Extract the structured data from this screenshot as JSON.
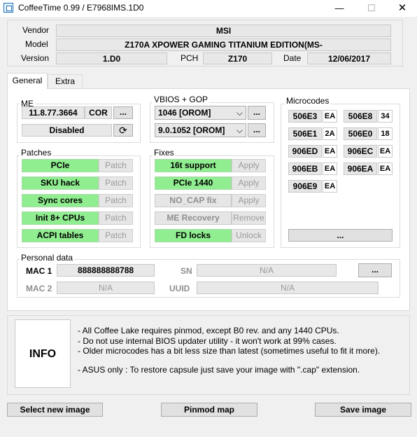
{
  "window": {
    "title": "CoffeeTime 0.99  /  E7968IMS.1D0",
    "minimize_glyph": "—",
    "maximize_glyph": "☐",
    "close_glyph": "✕"
  },
  "header": {
    "vendor_label": "Vendor",
    "vendor": "MSI",
    "model_label": "Model",
    "model": "Z170A XPOWER GAMING TITANIUM EDITION(MS-",
    "version_label": "Version",
    "version": "1.D0",
    "pch_label": "PCH",
    "pch": "Z170",
    "date_label": "Date",
    "date": "12/06/2017"
  },
  "tabs": [
    {
      "label": "General"
    },
    {
      "label": "Extra"
    }
  ],
  "me": {
    "title": "ME",
    "version": "11.8.77.3664",
    "type": "COR",
    "browse": "...",
    "state": "Disabled",
    "refresh_icon": "refresh-icon"
  },
  "vbios": {
    "title": "VBIOS + GOP",
    "vbios_value": "1046 [OROM]",
    "gop_value": "9.0.1052 [OROM]",
    "browse": "..."
  },
  "patches": {
    "title": "Patches",
    "items": [
      {
        "label": "PCIe",
        "action": "Patch"
      },
      {
        "label": "SKU hack",
        "action": "Patch"
      },
      {
        "label": "Sync cores",
        "action": "Patch"
      },
      {
        "label": "Init 8+ CPUs",
        "action": "Patch"
      },
      {
        "label": "ACPI tables",
        "action": "Patch"
      }
    ]
  },
  "fixes": {
    "title": "Fixes",
    "items": [
      {
        "label": "16t support",
        "action": "Apply",
        "active": true
      },
      {
        "label": "PCIe 1440",
        "action": "Apply",
        "active": true
      },
      {
        "label": "NO_CAP fix",
        "action": "Apply",
        "active": false
      },
      {
        "label": "ME Recovery",
        "action": "Remove",
        "active": false
      },
      {
        "label": "FD locks",
        "action": "Unlock",
        "active": true
      }
    ]
  },
  "microcodes": {
    "title": "Microcodes",
    "items": [
      {
        "cpuid": "506E3",
        "platform": "EA"
      },
      {
        "cpuid": "506E8",
        "platform": "34"
      },
      {
        "cpuid": "506E1",
        "platform": "2A"
      },
      {
        "cpuid": "506E0",
        "platform": "18"
      },
      {
        "cpuid": "906ED",
        "platform": "EA"
      },
      {
        "cpuid": "906EC",
        "platform": "EA"
      },
      {
        "cpuid": "906EB",
        "platform": "EA"
      },
      {
        "cpuid": "906EA",
        "platform": "EA"
      },
      {
        "cpuid": "906E9",
        "platform": "EA"
      }
    ],
    "browse": "..."
  },
  "personal": {
    "title": "Personal data",
    "mac1_label": "MAC 1",
    "mac1": "888888888788",
    "mac2_label": "MAC 2",
    "mac2": "N/A",
    "sn_label": "SN",
    "sn": "N/A",
    "uuid_label": "UUID",
    "uuid": "N/A",
    "browse": "..."
  },
  "info": {
    "box_label": "INFO",
    "lines": [
      "- All Coffee Lake requires pinmod, except B0 rev. and any 1440 CPUs.",
      "- Do not use internal BIOS updater utility - it won't work at 99% cases.",
      "- Older microcodes has a bit less size than latest (sometimes useful to fit it more).",
      "",
      "- ASUS only : To restore capsule just save your image with \".cap\" extension."
    ]
  },
  "footer": {
    "select_image": "Select new image",
    "pinmod_map": "Pinmod map",
    "save_image": "Save image"
  }
}
